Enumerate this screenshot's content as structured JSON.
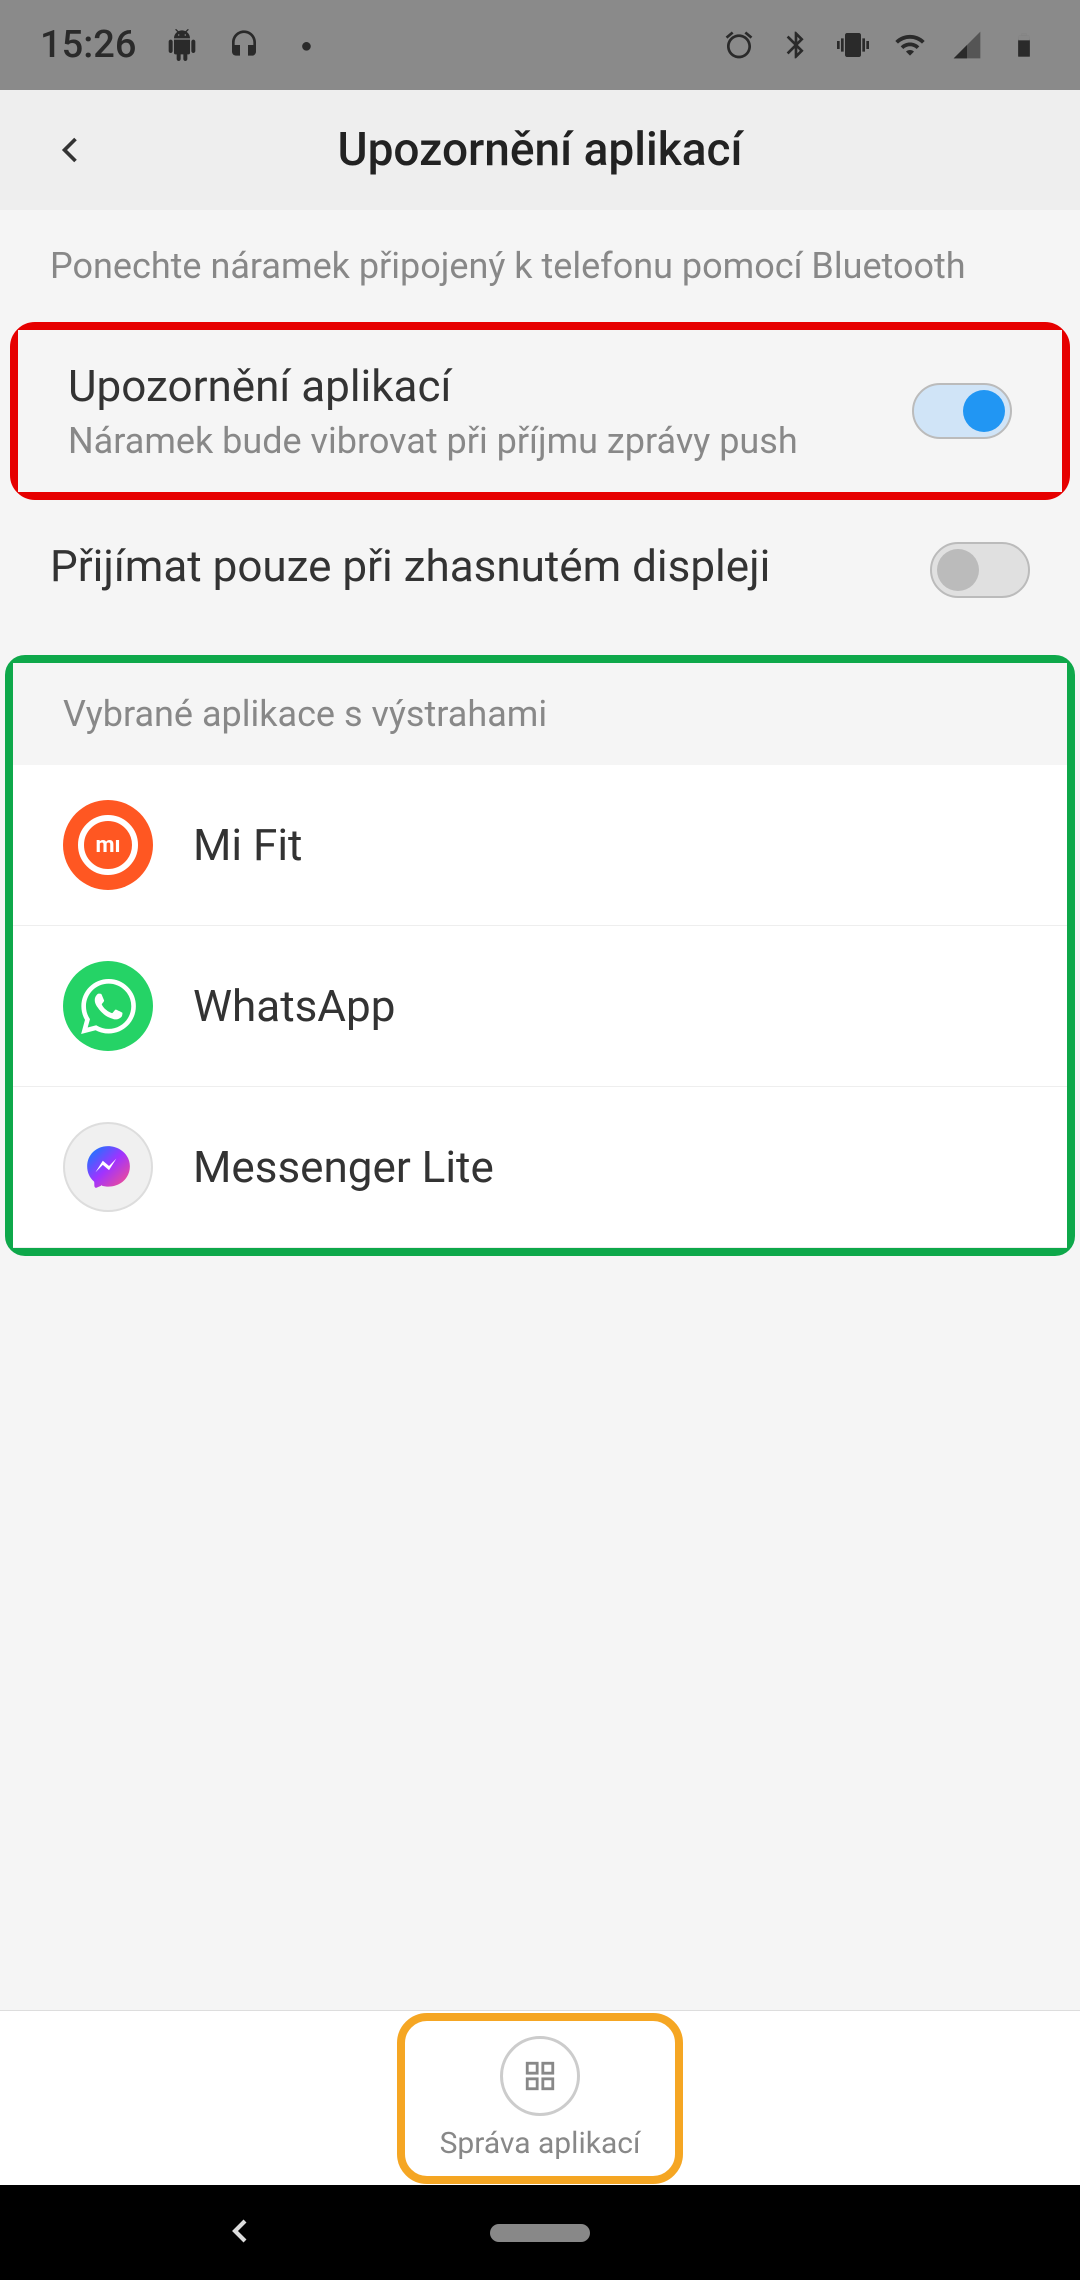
{
  "statusBar": {
    "time": "15:26"
  },
  "header": {
    "title": "Upozornění aplikací"
  },
  "infoText": "Ponechte náramek připojený k telefonu pomocí Bluetooth",
  "settings": {
    "appNotifications": {
      "title": "Upozornění aplikací",
      "subtitle": "Náramek bude vibrovat při příjmu zprávy push",
      "enabled": true
    },
    "screenOff": {
      "title": "Přijímat pouze při zhasnutém displeji",
      "enabled": false
    }
  },
  "selectedAppsHeader": "Vybrané aplikace s výstrahami",
  "apps": [
    {
      "name": "Mi Fit",
      "icon": "mifit"
    },
    {
      "name": "WhatsApp",
      "icon": "whatsapp"
    },
    {
      "name": "Messenger Lite",
      "icon": "messenger"
    }
  ],
  "manageApps": {
    "label": "Správa aplikací"
  }
}
